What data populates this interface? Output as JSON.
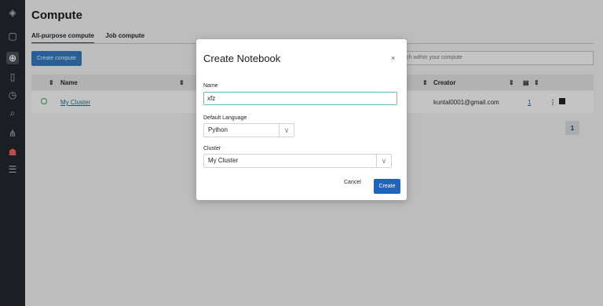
{
  "page": {
    "title": "Compute",
    "tabs": [
      "All-purpose compute",
      "Job compute"
    ],
    "create_compute_label": "Create compute",
    "search_placeholder": "rch within your compute",
    "table": {
      "columns": [
        "Name",
        "Creator"
      ],
      "rows": [
        {
          "name": "My Cluster",
          "creator": "kuntal0001@gmail.com",
          "notebooks": "1"
        }
      ]
    },
    "pagination": {
      "current_page": "1"
    }
  },
  "modal": {
    "title": "Create Notebook",
    "close_glyph": "×",
    "name_label": "Name",
    "name_value": "xfz",
    "language_label": "Default Language",
    "language_value": "Python",
    "cluster_label": "Cluster",
    "cluster_value": "My Cluster",
    "cancel_label": "Cancel",
    "create_label": "Create"
  },
  "icons": {
    "rail": [
      "logo-icon",
      "workspace-icon",
      "plus-icon",
      "folder-icon",
      "history-icon",
      "search-icon",
      "graph-icon",
      "compute-icon",
      "list-icon"
    ]
  },
  "colors": {
    "accent": "#1f65b8",
    "rail_bg": "#1b1f24",
    "focus_border": "#62b6d6"
  }
}
